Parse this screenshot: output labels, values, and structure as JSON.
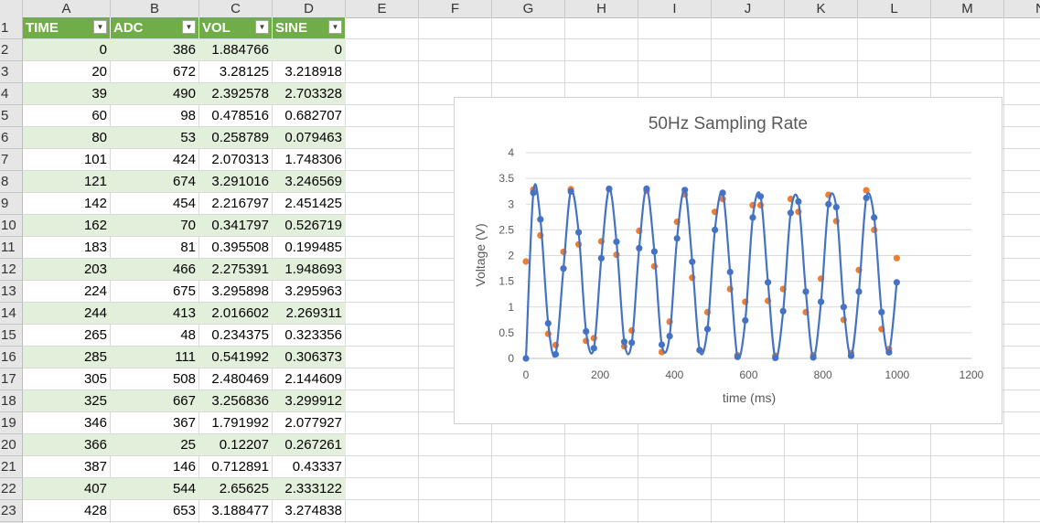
{
  "columns": [
    "A",
    "B",
    "C",
    "D",
    "E",
    "F",
    "G",
    "H",
    "I",
    "J",
    "K",
    "L",
    "M",
    "N"
  ],
  "rows": [
    "1",
    "2",
    "3",
    "4",
    "5",
    "6",
    "7",
    "8",
    "9",
    "10",
    "11",
    "12",
    "13",
    "14",
    "15",
    "16",
    "17",
    "18",
    "19",
    "20",
    "21",
    "22",
    "23"
  ],
  "table": {
    "headers": [
      "TIME",
      "ADC",
      "VOL",
      "SINE"
    ],
    "rows": [
      [
        "0",
        "386",
        "1.884766",
        "0"
      ],
      [
        "20",
        "672",
        "3.28125",
        "3.218918"
      ],
      [
        "39",
        "490",
        "2.392578",
        "2.703328"
      ],
      [
        "60",
        "98",
        "0.478516",
        "0.682707"
      ],
      [
        "80",
        "53",
        "0.258789",
        "0.079463"
      ],
      [
        "101",
        "424",
        "2.070313",
        "1.748306"
      ],
      [
        "121",
        "674",
        "3.291016",
        "3.246569"
      ],
      [
        "142",
        "454",
        "2.216797",
        "2.451425"
      ],
      [
        "162",
        "70",
        "0.341797",
        "0.526719"
      ],
      [
        "183",
        "81",
        "0.395508",
        "0.199485"
      ],
      [
        "203",
        "466",
        "2.275391",
        "1.948693"
      ],
      [
        "224",
        "675",
        "3.295898",
        "3.295963"
      ],
      [
        "244",
        "413",
        "2.016602",
        "2.269311"
      ],
      [
        "265",
        "48",
        "0.234375",
        "0.323356"
      ],
      [
        "285",
        "111",
        "0.541992",
        "0.306373"
      ],
      [
        "305",
        "508",
        "2.480469",
        "2.144609"
      ],
      [
        "325",
        "667",
        "3.256836",
        "3.299912"
      ],
      [
        "346",
        "367",
        "1.791992",
        "2.077927"
      ],
      [
        "366",
        "25",
        "0.12207",
        "0.267261"
      ],
      [
        "387",
        "146",
        "0.712891",
        "0.43337"
      ],
      [
        "407",
        "544",
        "2.65625",
        "2.333122"
      ],
      [
        "428",
        "653",
        "3.188477",
        "3.274838"
      ]
    ]
  },
  "colors": {
    "header_green": "#70ad47",
    "band_green": "#e2efda",
    "vol_series": "#ed7d31",
    "sine_series": "#4472c4"
  },
  "chart_data": {
    "type": "scatter",
    "title": "50Hz Sampling Rate",
    "xlabel": "time (ms)",
    "ylabel": "Voltage (V)",
    "xlim": [
      0,
      1200
    ],
    "ylim": [
      0,
      4
    ],
    "xticks": [
      "0",
      "200",
      "400",
      "600",
      "800",
      "1000",
      "1200"
    ],
    "yticks": [
      "0",
      "0.5",
      "1",
      "1.5",
      "2",
      "2.5",
      "3",
      "3.5",
      "4"
    ],
    "grid": true,
    "series": [
      {
        "style": "markers",
        "color": "#ed7d31",
        "x": [
          0,
          20,
          39,
          60,
          80,
          101,
          121,
          142,
          162,
          183,
          203,
          224,
          244,
          265,
          285,
          305,
          325,
          346,
          366,
          387,
          407,
          428,
          448,
          468,
          489,
          509,
          530,
          550,
          570,
          591,
          611,
          632,
          652,
          672,
          693,
          713,
          734,
          754,
          774,
          795,
          815,
          836,
          856,
          876,
          897,
          917,
          938,
          958,
          978,
          999
        ],
        "y": [
          1.884766,
          3.28125,
          2.392578,
          0.478516,
          0.258789,
          2.070313,
          3.291016,
          2.216797,
          0.341797,
          0.395508,
          2.275391,
          3.295898,
          2.016602,
          0.234375,
          0.541992,
          2.480469,
          3.256836,
          1.791992,
          0.12207,
          0.712891,
          2.65625,
          3.188477,
          1.57,
          0.16,
          0.9,
          2.85,
          3.1,
          1.35,
          0.06,
          1.1,
          2.98,
          2.98,
          1.12,
          0.05,
          1.35,
          3.1,
          2.85,
          0.9,
          0.06,
          1.55,
          3.18,
          2.67,
          0.75,
          0.1,
          1.72,
          3.27,
          2.5,
          0.57,
          0.18,
          1.95
        ]
      },
      {
        "style": "line-markers",
        "color": "#4472c4",
        "x": [
          0,
          20,
          39,
          60,
          80,
          101,
          121,
          142,
          162,
          183,
          203,
          224,
          244,
          265,
          285,
          305,
          325,
          346,
          366,
          387,
          407,
          428,
          448,
          468,
          489,
          509,
          530,
          550,
          570,
          591,
          611,
          632,
          652,
          672,
          693,
          713,
          734,
          754,
          774,
          795,
          815,
          836,
          856,
          876,
          897,
          917,
          938,
          958,
          978,
          999
        ],
        "y": [
          0,
          3.218918,
          2.703328,
          0.682707,
          0.079463,
          1.748306,
          3.246569,
          2.451425,
          0.526719,
          0.199485,
          1.948693,
          3.295963,
          2.269311,
          0.323356,
          0.306373,
          2.144609,
          3.299912,
          2.077927,
          0.267261,
          0.43337,
          2.333122,
          3.274838,
          1.88,
          0.16,
          0.57,
          2.5,
          3.22,
          1.68,
          0.03,
          0.74,
          2.74,
          3.15,
          1.48,
          0.01,
          0.92,
          2.83,
          3.05,
          1.3,
          0.02,
          1.1,
          3.0,
          2.94,
          1.0,
          0.05,
          1.3,
          3.12,
          2.74,
          0.9,
          0.12,
          1.48
        ]
      }
    ]
  }
}
